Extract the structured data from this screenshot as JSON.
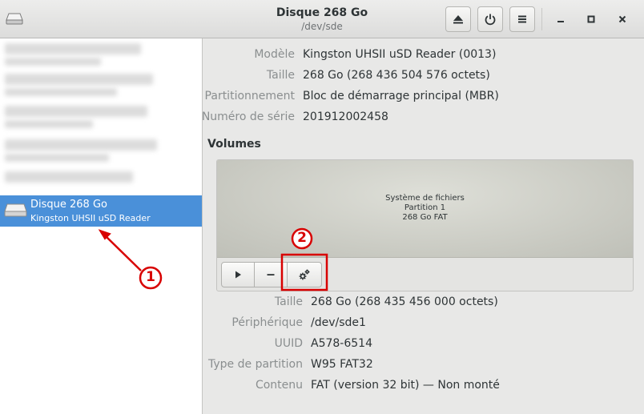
{
  "window": {
    "title": "Disque 268 Go",
    "subtitle": "/dev/sde"
  },
  "sidebar": {
    "selected_title": "Disque 268 Go",
    "selected_subtitle": "Kingston UHSII uSD Reader"
  },
  "drive_info": [
    {
      "label": "Modèle",
      "value": "Kingston UHSII uSD Reader (0013)"
    },
    {
      "label": "Taille",
      "value": "268 Go (268 436 504 576 octets)"
    },
    {
      "label": "Partitionnement",
      "value": "Bloc de démarrage principal (MBR)"
    },
    {
      "label": "Numéro de série",
      "value": "201912002458"
    }
  ],
  "volumes": {
    "heading": "Volumes",
    "partition_lines": [
      "Système de fichiers",
      "Partition 1",
      "268 Go FAT"
    ]
  },
  "volume_info": [
    {
      "label": "Taille",
      "value": "268 Go (268 435 456 000 octets)"
    },
    {
      "label": "Périphérique",
      "value": "/dev/sde1"
    },
    {
      "label": "UUID",
      "value": "A578-6514"
    },
    {
      "label": "Type de partition",
      "value": "W95 FAT32"
    },
    {
      "label": "Contenu",
      "value": "FAT (version 32 bit) — Non monté"
    }
  ],
  "annotations": {
    "marker_1": "1",
    "marker_2": "2",
    "color": "#d80000"
  },
  "icons": {
    "app": "drive-icon",
    "eject": "eject-icon",
    "power": "power-icon",
    "menu": "hamburger-menu-icon",
    "minimize": "minimize-icon",
    "maximize": "maximize-icon",
    "close": "close-icon",
    "play": "play-icon",
    "remove": "minus-icon",
    "settings": "gears-icon"
  },
  "colors": {
    "selection": "#4a90d9"
  }
}
